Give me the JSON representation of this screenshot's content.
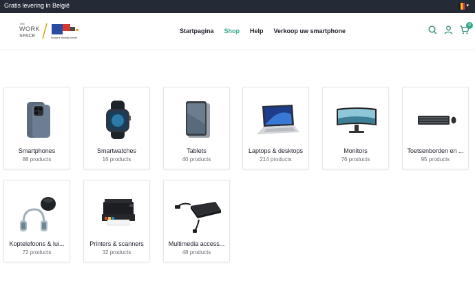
{
  "topbar": {
    "announcement": "Gratis levering in België",
    "flag_colors": [
      "#1a1a1a",
      "#f5c518",
      "#e03a3e"
    ],
    "chevron": "chevron-down-icon"
  },
  "header": {
    "logo": {
      "small_text": "THE",
      "line1": "WORK",
      "line2": "SPACE",
      "slogan": "Europe's refurbish bedrijf"
    },
    "nav": [
      {
        "label": "Startpagina"
      },
      {
        "label": "Shop",
        "active": true
      },
      {
        "label": "Help"
      },
      {
        "label": "Verkoop uw smartphone"
      }
    ],
    "icons": [
      "search-icon",
      "user-icon",
      "cart-icon"
    ],
    "cart_count": "0",
    "accent": "#3aa78c"
  },
  "categories": [
    {
      "name": "Smartphones",
      "count": "88 products",
      "icon": "smartphone-image"
    },
    {
      "name": "Smartwatches",
      "count": "16 products",
      "icon": "smartwatch-image"
    },
    {
      "name": "Tablets",
      "count": "40 products",
      "icon": "tablet-image"
    },
    {
      "name": "Laptops & desktops",
      "count": "214 products",
      "icon": "laptop-image"
    },
    {
      "name": "Monitors",
      "count": "76 products",
      "icon": "monitor-image"
    },
    {
      "name": "Toetsenborden en ...",
      "count": "95 products",
      "icon": "keyboard-image"
    },
    {
      "name": "Koptelefoons & lui...",
      "count": "72 products",
      "icon": "headphones-image"
    },
    {
      "name": "Printers & scanners",
      "count": "32 products",
      "icon": "printer-image"
    },
    {
      "name": "Multimedia access...",
      "count": "48 products",
      "icon": "dock-image"
    }
  ]
}
